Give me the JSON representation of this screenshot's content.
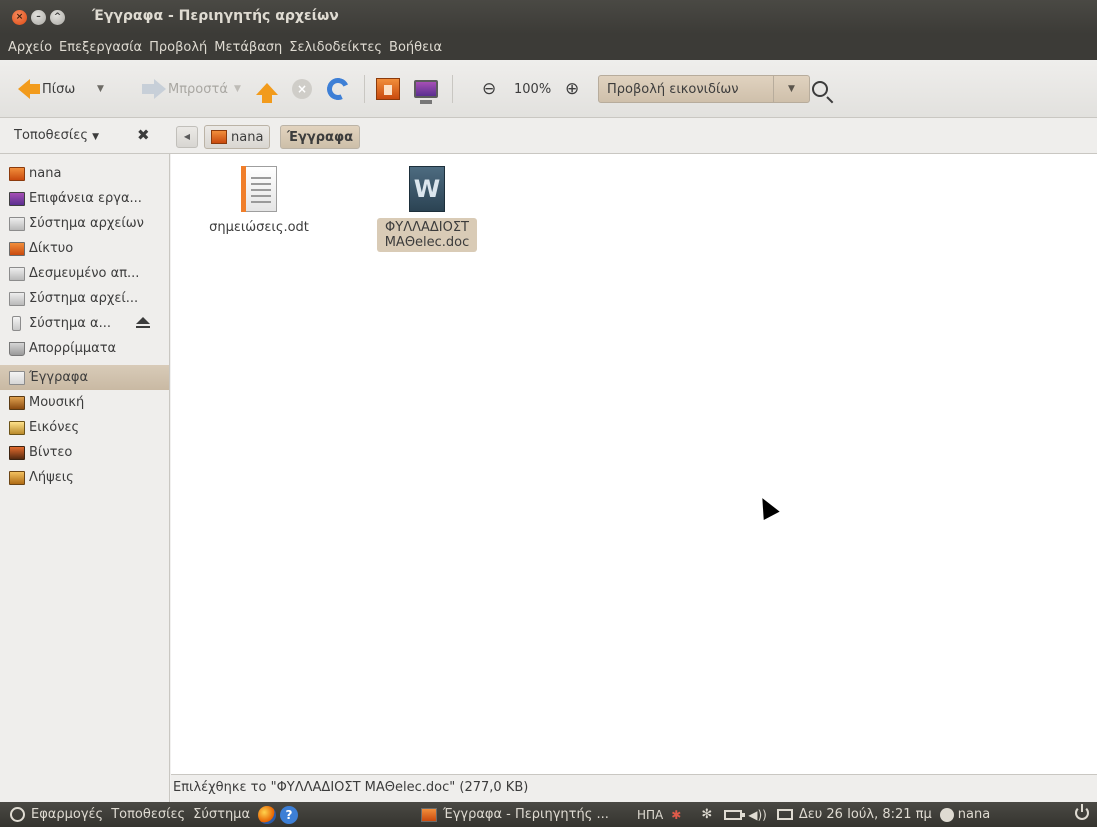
{
  "window": {
    "title": "Έγγραφα - Περιηγητής αρχείων"
  },
  "menubar": [
    "Αρχείο",
    "Επεξεργασία",
    "Προβολή",
    "Μετάβαση",
    "Σελιδοδείκτες",
    "Βοήθεια"
  ],
  "toolbar": {
    "back_label": "Πίσω",
    "forward_label": "Μπροστά",
    "zoom": "100%",
    "view_mode": "Προβολή εικονιδίων"
  },
  "location": {
    "places_label": "Τοποθεσίες",
    "crumbs": [
      "nana",
      "Έγγραφα"
    ]
  },
  "sidebar": {
    "devices": [
      "nana",
      "Επιφάνεια εργα...",
      "Σύστημα αρχείων",
      "Δίκτυο",
      "Δεσμευμένο απ...",
      "Σύστημα αρχεί...",
      "Σύστημα α...",
      "Απορρίμματα"
    ],
    "bookmarks": [
      "Έγγραφα",
      "Μουσική",
      "Εικόνες",
      "Βίντεο",
      "Λήψεις"
    ]
  },
  "files": [
    {
      "name": "σημειώσεις.odt",
      "icon": "odt-document-icon"
    },
    {
      "name_line1": "ΦΥΛΛΑΔΙΟΣΤ",
      "name_line2": "ΜΑΘelec.doc",
      "icon_letter": "W"
    }
  ],
  "status": "Επιλέχθηκε το \"ΦΥΛΛΑΔΙΟΣΤ ΜΑΘelec.doc\" (277,0 KB)",
  "panel": {
    "menus": [
      "Εφαρμογές",
      "Τοποθεσίες",
      "Σύστημα"
    ],
    "task": "Έγγραφα - Περιηγητής ...",
    "keyboard": "ΗΠΑ",
    "clock": "Δευ 26 Ιούλ, 8:21 πμ",
    "user": "nana"
  }
}
